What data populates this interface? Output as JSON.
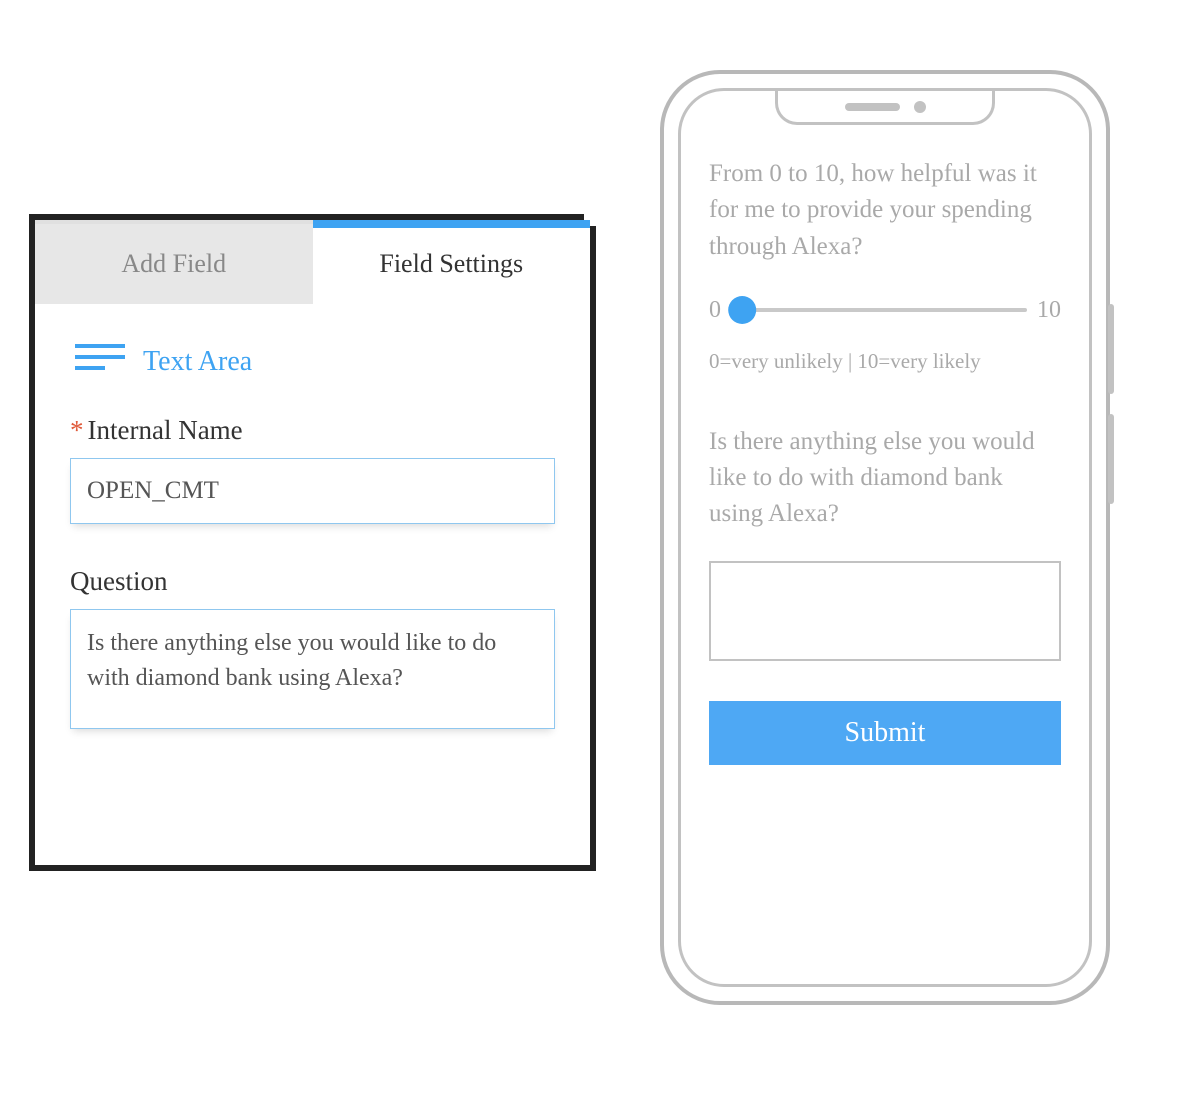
{
  "panel": {
    "tabs": {
      "add": "Add Field",
      "settings": "Field Settings"
    },
    "field_type_label": "Text Area",
    "internal_name_label": "Internal Name",
    "internal_name_value": "OPEN_CMT",
    "question_label": "Question",
    "question_value": "Is there anything else you would like to do with diamond bank using Alexa?"
  },
  "phone": {
    "q1": "From 0 to 10, how helpful was it for me to provide your spending through Alexa?",
    "slider_min": "0",
    "slider_max": "10",
    "slider_caption": "0=very unlikely | 10=very likely",
    "q2": "Is there anything else you would like to do with diamond bank using Alexa?",
    "submit": "Submit"
  }
}
